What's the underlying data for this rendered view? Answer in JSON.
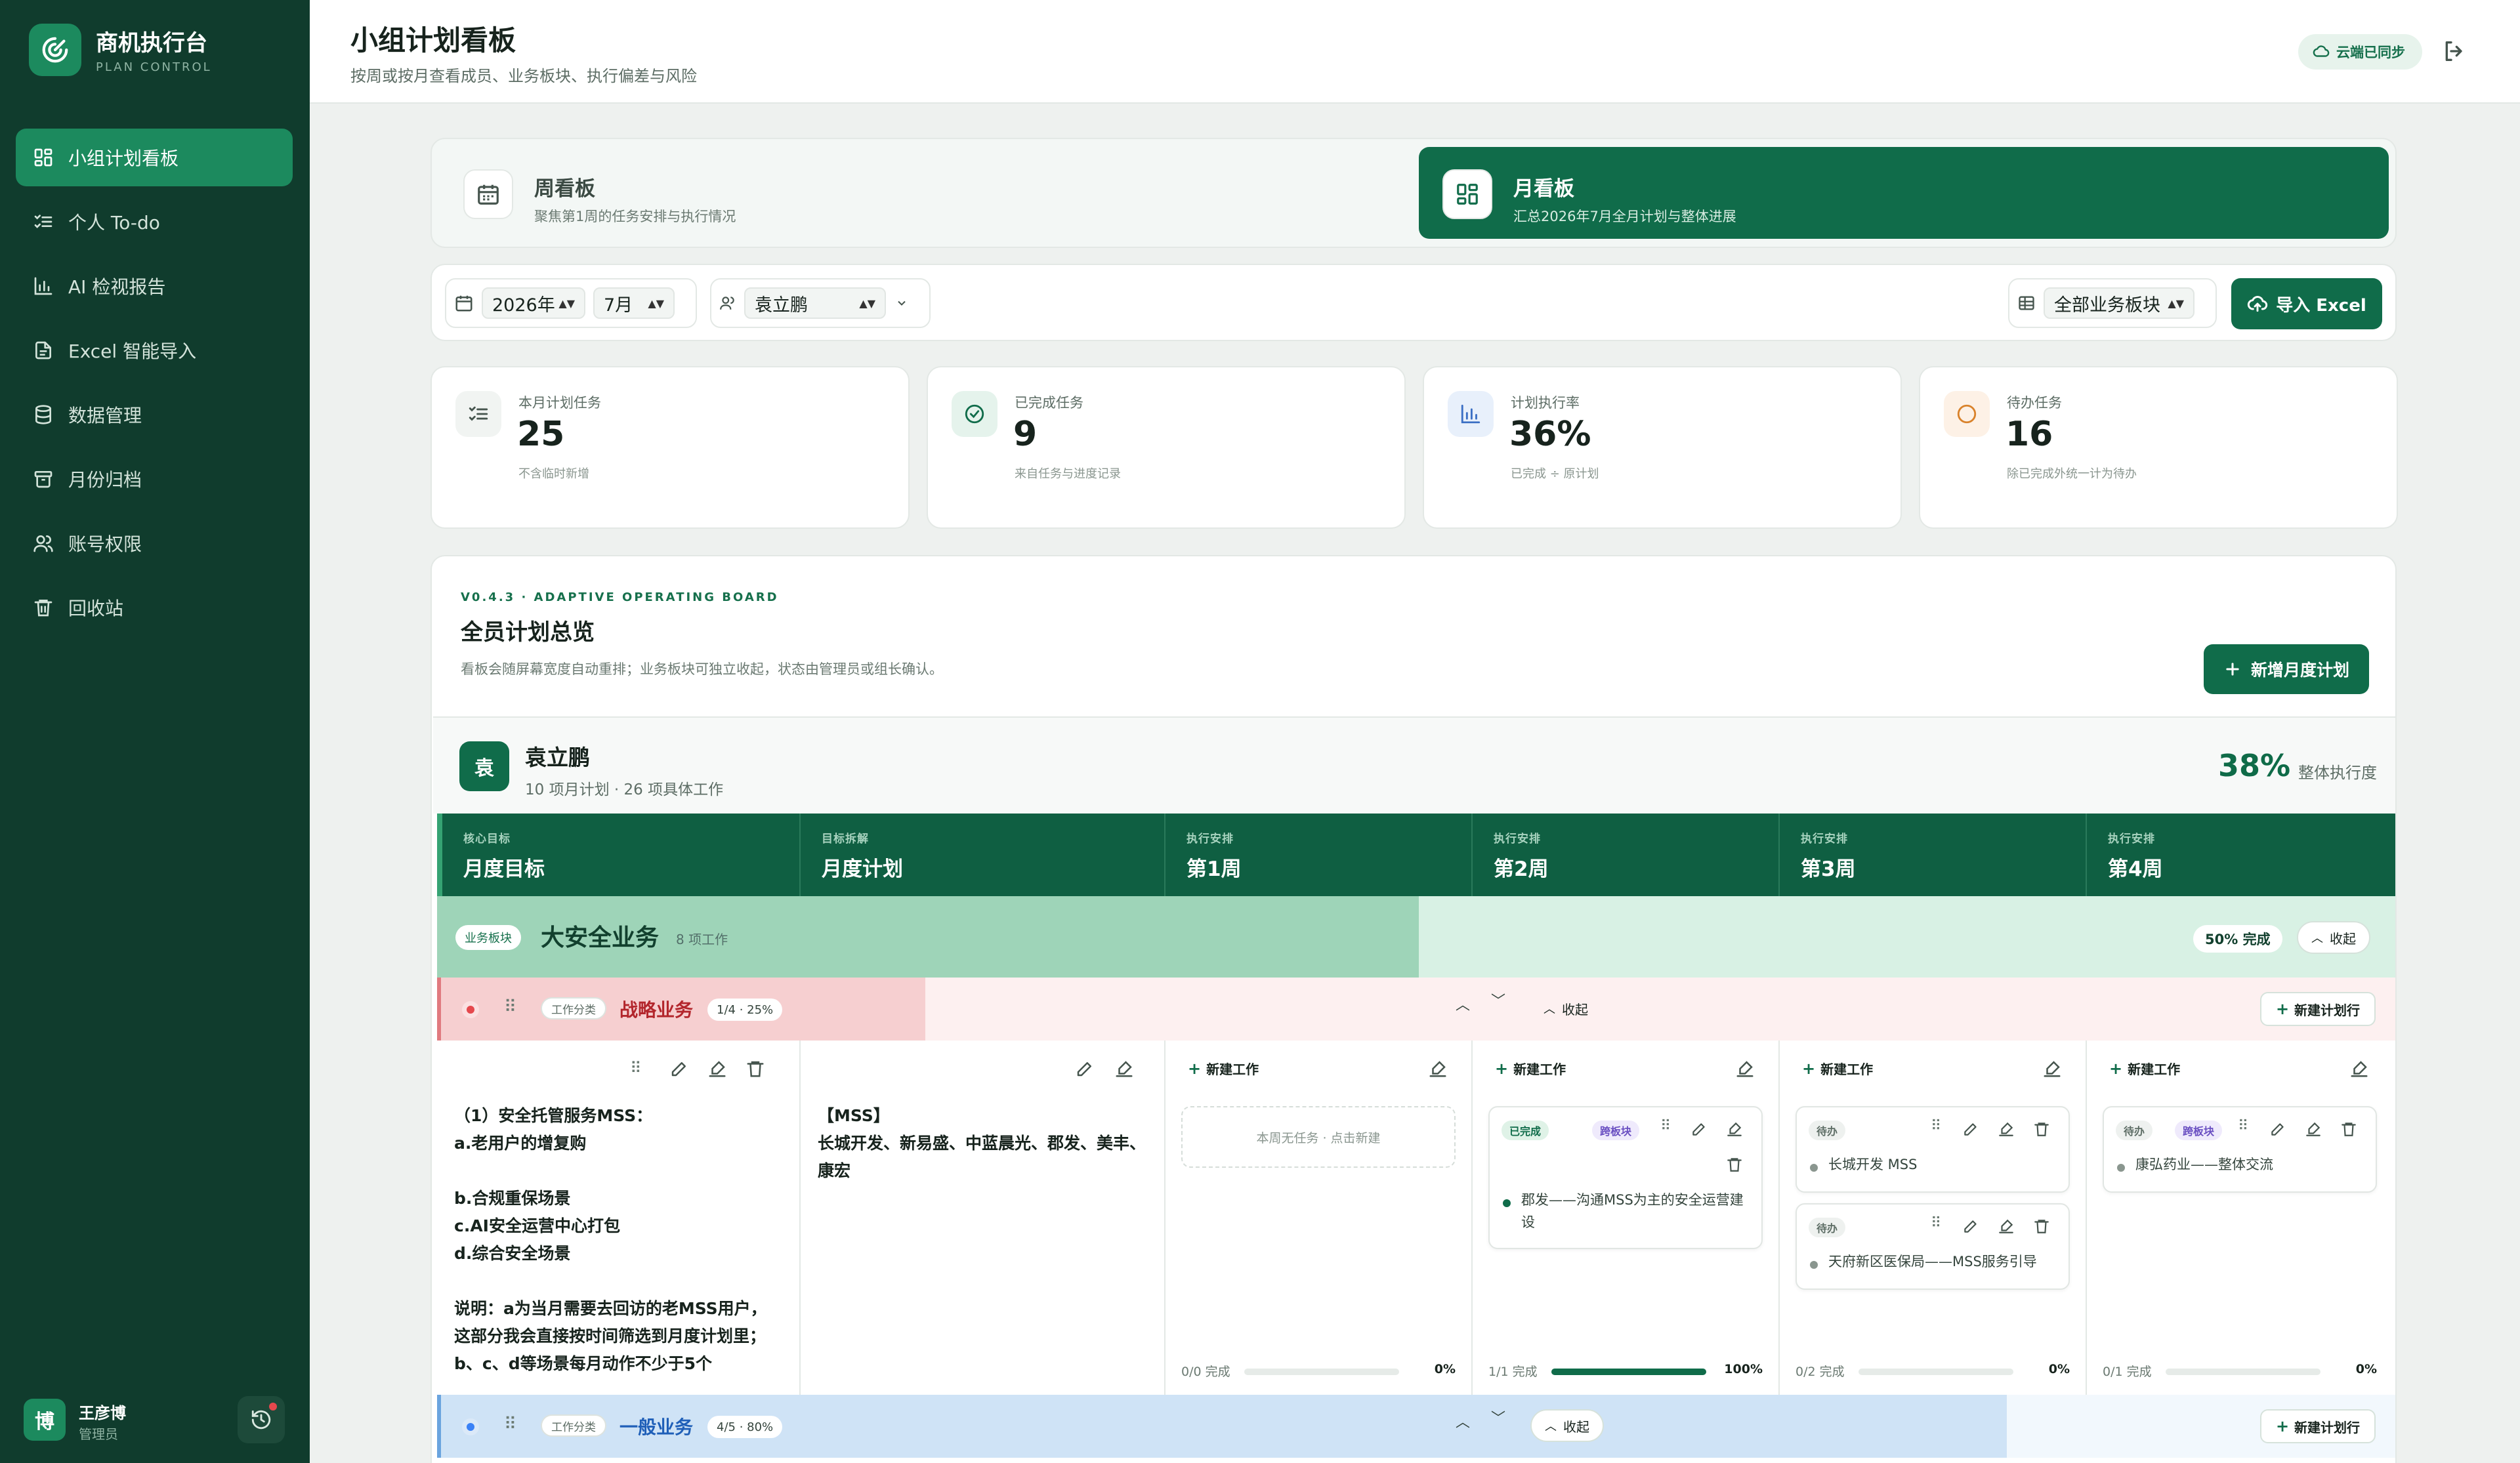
{
  "sidebar": {
    "brand_name": "商机执行台",
    "brand_sub": "PLAN CONTROL",
    "items": [
      {
        "label": "小组计划看板",
        "icon": "dashboard-icon",
        "active": true
      },
      {
        "label": "个人 To-do",
        "icon": "checklist-icon",
        "active": false
      },
      {
        "label": "AI 检视报告",
        "icon": "bar-chart-icon",
        "active": false
      },
      {
        "label": "Excel 智能导入",
        "icon": "file-icon",
        "active": false
      },
      {
        "label": "数据管理",
        "icon": "database-icon",
        "active": false
      },
      {
        "label": "月份归档",
        "icon": "archive-icon",
        "active": false
      },
      {
        "label": "账号权限",
        "icon": "users-icon",
        "active": false
      },
      {
        "label": "回收站",
        "icon": "trash-icon",
        "active": false
      }
    ],
    "user": {
      "avatar": "博",
      "name": "王彦博",
      "role": "管理员"
    }
  },
  "header": {
    "title": "小组计划看板",
    "subtitle": "按周或按月查看成员、业务板块、执行偏差与风险",
    "sync_label": "云端已同步"
  },
  "view_tabs": {
    "week": {
      "title": "周看板",
      "desc": "聚焦第1周的任务安排与执行情况"
    },
    "month": {
      "title": "月看板",
      "desc": "汇总2026年7月全月计划与整体进展"
    }
  },
  "filters": {
    "year": "2026年",
    "month": "7月",
    "member": "袁立鹏",
    "segment": "全部业务板块",
    "import_label": "导入 Excel"
  },
  "stats": [
    {
      "label": "本月计划任务",
      "value": "25",
      "desc": "不含临时新增",
      "icon": "checklist-icon",
      "color": "#f1f4f2"
    },
    {
      "label": "已完成任务",
      "value": "9",
      "desc": "来自任务与进度记录",
      "icon": "check-circle-icon",
      "color": "#e5f3ec"
    },
    {
      "label": "计划执行率",
      "value": "36%",
      "desc": "已完成 ÷ 原计划",
      "icon": "bar-chart-icon",
      "color": "#e8f0fb"
    },
    {
      "label": "待办任务",
      "value": "16",
      "desc": "除已完成外统一计为待办",
      "icon": "circle-icon",
      "color": "#fdf1e6"
    }
  ],
  "board": {
    "version": "V0.4.3 · ADAPTIVE OPERATING BOARD",
    "title": "全员计划总览",
    "desc": "看板会随屏幕宽度自动重排；业务板块可独立收起，状态由管理员或组长确认。",
    "add_label": "新增月度计划",
    "member": {
      "avatar": "袁",
      "name": "袁立鹏",
      "sub": "10 项月计划 · 26 项具体工作",
      "pct": "38%",
      "pct_label": "整体执行度"
    },
    "columns": [
      {
        "small": "核心目标",
        "label": "月度目标"
      },
      {
        "small": "目标拆解",
        "label": "月度计划"
      },
      {
        "small": "执行安排",
        "label": "第1周"
      },
      {
        "small": "执行安排",
        "label": "第2周"
      },
      {
        "small": "执行安排",
        "label": "第3周"
      },
      {
        "small": "执行安排",
        "label": "第4周"
      }
    ],
    "segment": {
      "tag": "业务板块",
      "name": "大安全业务",
      "count": "8 项工作",
      "pct_label": "50% 完成",
      "pct_value": 0.5,
      "fold_label": "收起"
    },
    "categories": [
      {
        "tag": "工作分类",
        "name": "战略业务",
        "progress": "1/4 · 25%",
        "progress_value": 0.25,
        "fold_label": "收起",
        "new_line_label": "新建计划行",
        "color": "#e5484d"
      },
      {
        "tag": "工作分类",
        "name": "一般业务",
        "progress": "4/5 · 80%",
        "progress_value": 0.8,
        "fold_label": "收起",
        "new_line_label": "新建计划行",
        "color": "#3b82f6"
      }
    ],
    "row": {
      "goal": "（1）安全托管服务MSS：\na.老用户的增复购\n\nb.合规重保场景\nc.AI安全运营中心打包\nd.综合安全场景\n\n说明：a为当月需要去回访的老MSS用户，\n这部分我会直接按时间筛选到月度计划里；\nb、c、d等场景每月动作不少于5个",
      "plan": "【MSS】\n长城开发、新易盛、中蓝晨光、郡发、美丰、康宏",
      "new_work_label": "新建工作",
      "empty_label": "本周无任务 · 点击新建",
      "weeks": [
        {
          "tasks": [],
          "foot": "0/0 完成",
          "pct": "0%",
          "value": 0
        },
        {
          "tasks": [
            {
              "status": "已完成",
              "cross": "跨板块",
              "text": "郡发——沟通MSS为主的安全运营建设"
            }
          ],
          "foot": "1/1 完成",
          "pct": "100%",
          "value": 1
        },
        {
          "tasks": [
            {
              "status": "待办",
              "text": "长城开发 MSS"
            },
            {
              "status": "待办",
              "text": "天府新区医保局——MSS服务引导"
            }
          ],
          "foot": "0/2 完成",
          "pct": "0%",
          "value": 0
        },
        {
          "tasks": [
            {
              "status": "待办",
              "cross": "跨板块",
              "text": "康弘药业——整体交流"
            }
          ],
          "foot": "0/1 完成",
          "pct": "0%",
          "value": 0
        }
      ]
    }
  }
}
